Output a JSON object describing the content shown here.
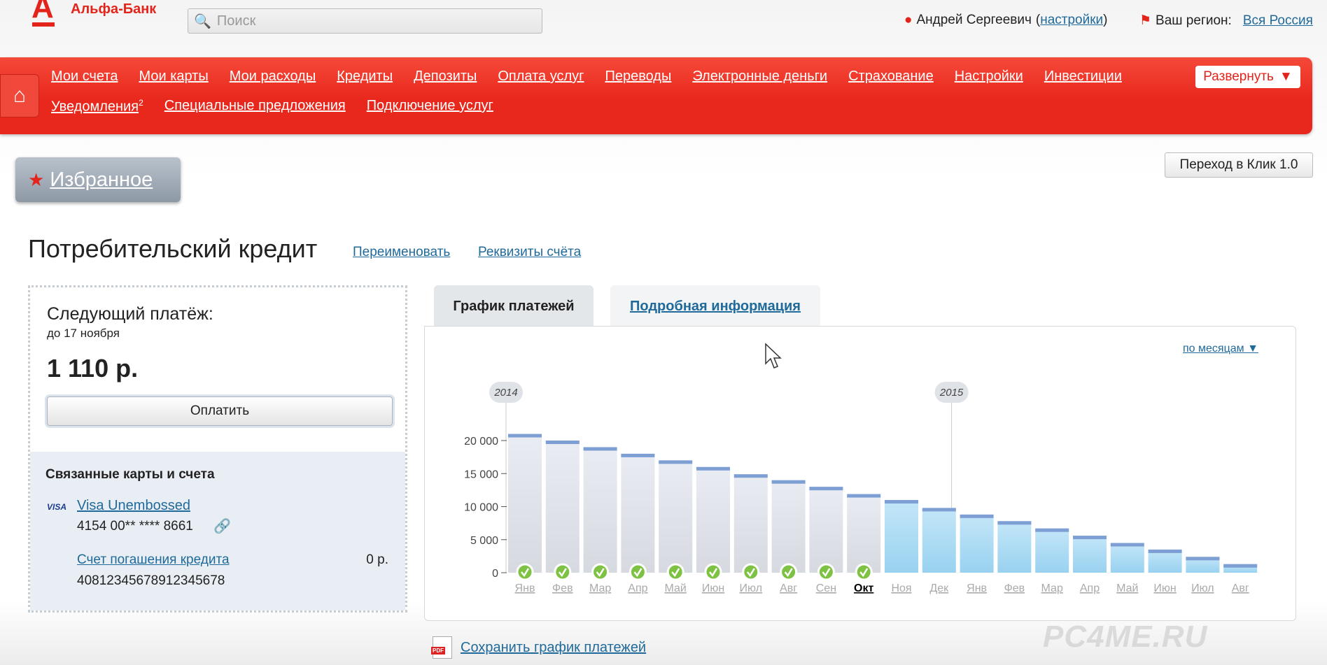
{
  "header": {
    "logo_text": "Альфа-Банк",
    "search_placeholder": "Поиск",
    "user_name": "Андрей Сергеевич",
    "settings_link": "настройки",
    "region_label": "Ваш регион:",
    "region_value": "Вся Россия"
  },
  "nav": {
    "row1": [
      "Мои счета",
      "Мои карты",
      "Мои расходы",
      "Кредиты",
      "Депозиты",
      "Оплата услуг",
      "Переводы",
      "Электронные деньги",
      "Страхование",
      "Настройки",
      "Инвестиции"
    ],
    "notifications": "Уведомления",
    "notifications_count": "2",
    "row2": [
      "Специальные предложения",
      "Подключение услуг"
    ],
    "expand": "Развернуть"
  },
  "favorites": "Избранное",
  "klik_button": "Переход в Клик 1.0",
  "page": {
    "title": "Потребительский кредит",
    "rename": "Переименовать",
    "requisites": "Реквизиты счёта"
  },
  "payment": {
    "label": "Следующий платёж:",
    "due": "до 17 ноября",
    "amount": "1 110 р.",
    "pay_button": "Оплатить"
  },
  "linked": {
    "title": "Связанные карты и счета",
    "card_brand": "VISA",
    "card_name": "Visa Unembossed",
    "card_number": "4154 00** **** 8661",
    "account_name": "Счет погашения кредита",
    "account_balance": "0 р.",
    "account_number": "40812345678912345678"
  },
  "tabs": [
    "График платежей",
    "Подробная информация"
  ],
  "period_select": "по месяцам ▼",
  "save_link": "Сохранить график платежей",
  "watermark": "PC4ME.RU",
  "colors": {
    "brand": "#e3241b",
    "paid_bar": "#dde2ea",
    "future_bar": "#a9d8f3",
    "bar_cap": "#7d9fd4",
    "check": "#7dc242"
  },
  "chart_data": {
    "type": "bar",
    "years": [
      {
        "label": "2014",
        "start_index": 0
      },
      {
        "label": "2015",
        "start_index": 12
      }
    ],
    "categories": [
      "Янв",
      "Фев",
      "Мар",
      "Апр",
      "Май",
      "Июн",
      "Июл",
      "Авг",
      "Сен",
      "Окт",
      "Ноя",
      "Дек",
      "Янв",
      "Фев",
      "Мар",
      "Апр",
      "Май",
      "Июн",
      "Июл",
      "Авг"
    ],
    "values": [
      21000,
      20000,
      19000,
      18000,
      17000,
      16000,
      14900,
      14000,
      13000,
      11900,
      11000,
      9800,
      8800,
      7800,
      6700,
      5600,
      4500,
      3500,
      2400,
      1300
    ],
    "paid": [
      true,
      true,
      true,
      true,
      true,
      true,
      true,
      true,
      true,
      true,
      false,
      false,
      false,
      false,
      false,
      false,
      false,
      false,
      false,
      false
    ],
    "current_index": 9,
    "yticks": [
      "0",
      "5 000",
      "10 000",
      "15 000",
      "20 000"
    ],
    "ytick_values": [
      0,
      5000,
      10000,
      15000,
      20000
    ],
    "ylim": [
      0,
      25000
    ]
  }
}
